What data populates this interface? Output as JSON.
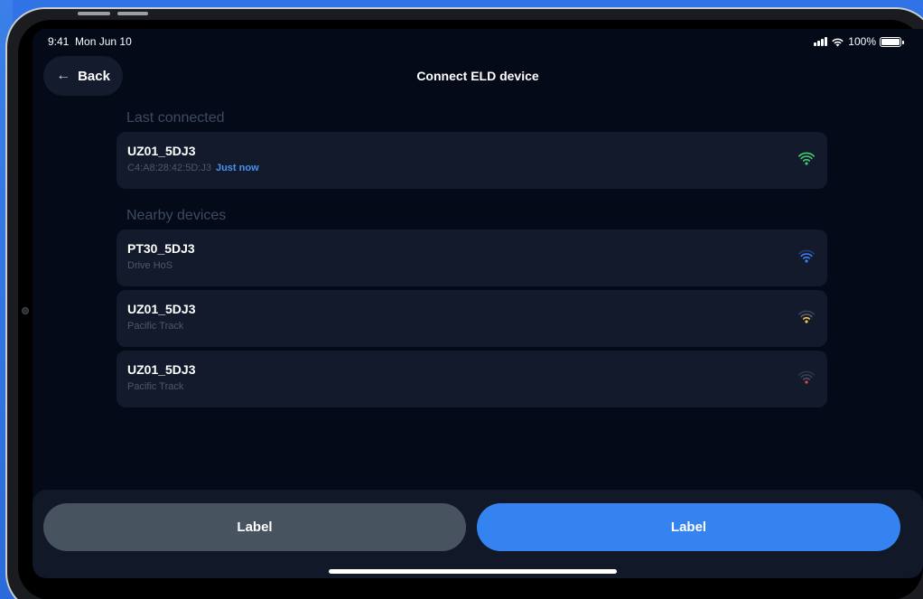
{
  "status_bar": {
    "time": "9:41",
    "date": "Mon Jun 10",
    "battery": "100%"
  },
  "header": {
    "back_label": "Back",
    "title": "Connect ELD device"
  },
  "last_connected": {
    "section_title": "Last connected",
    "device": {
      "name": "UZ01_5DJ3",
      "mac": "C4:A8:28:42:5D:J3",
      "time": "Just now",
      "signal_color": "#3ecf6e"
    }
  },
  "nearby": {
    "section_title": "Nearby devices",
    "devices": [
      {
        "name": "PT30_5DJ3",
        "provider": "Drive HoS",
        "signal_color": "#3b82f6"
      },
      {
        "name": "UZ01_5DJ3",
        "provider": "Pacific Track",
        "signal_color": "#f5c542"
      },
      {
        "name": "UZ01_5DJ3",
        "provider": "Pacific Track",
        "signal_color": "#ef4444"
      }
    ]
  },
  "footer": {
    "secondary_label": "Label",
    "primary_label": "Label"
  },
  "colors": {
    "accent": "#3483f0",
    "background": "#050a18",
    "card": "#131a2b"
  }
}
